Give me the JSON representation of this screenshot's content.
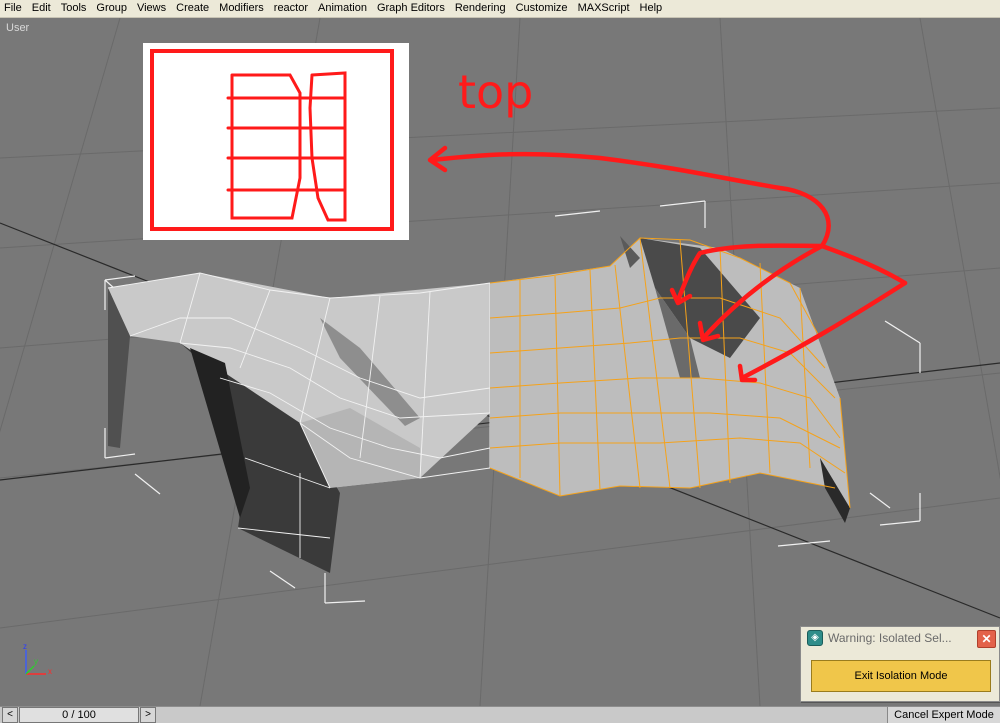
{
  "menubar": {
    "items": [
      "File",
      "Edit",
      "Tools",
      "Group",
      "Views",
      "Create",
      "Modifiers",
      "reactor",
      "Animation",
      "Graph Editors",
      "Rendering",
      "Customize",
      "MAXScript",
      "Help"
    ]
  },
  "viewport": {
    "label": "User",
    "annotation_text": "top"
  },
  "axis_gizmo": {
    "x": "x",
    "y": "y",
    "z": "z"
  },
  "warning": {
    "icon": "max-app-icon",
    "title": "Warning: Isolated Sel...",
    "close_icon": "close-icon",
    "button_label": "Exit Isolation Mode"
  },
  "status": {
    "prev_icon": "chevron-left-icon",
    "next_icon": "chevron-right-icon",
    "time_slider": "0 / 100",
    "cancel_expert": "Cancel Expert Mode"
  },
  "colors": {
    "annotation_red": "#ff1a1a",
    "selection_orange": "#f5a21a",
    "viewport_bg": "#787878"
  }
}
